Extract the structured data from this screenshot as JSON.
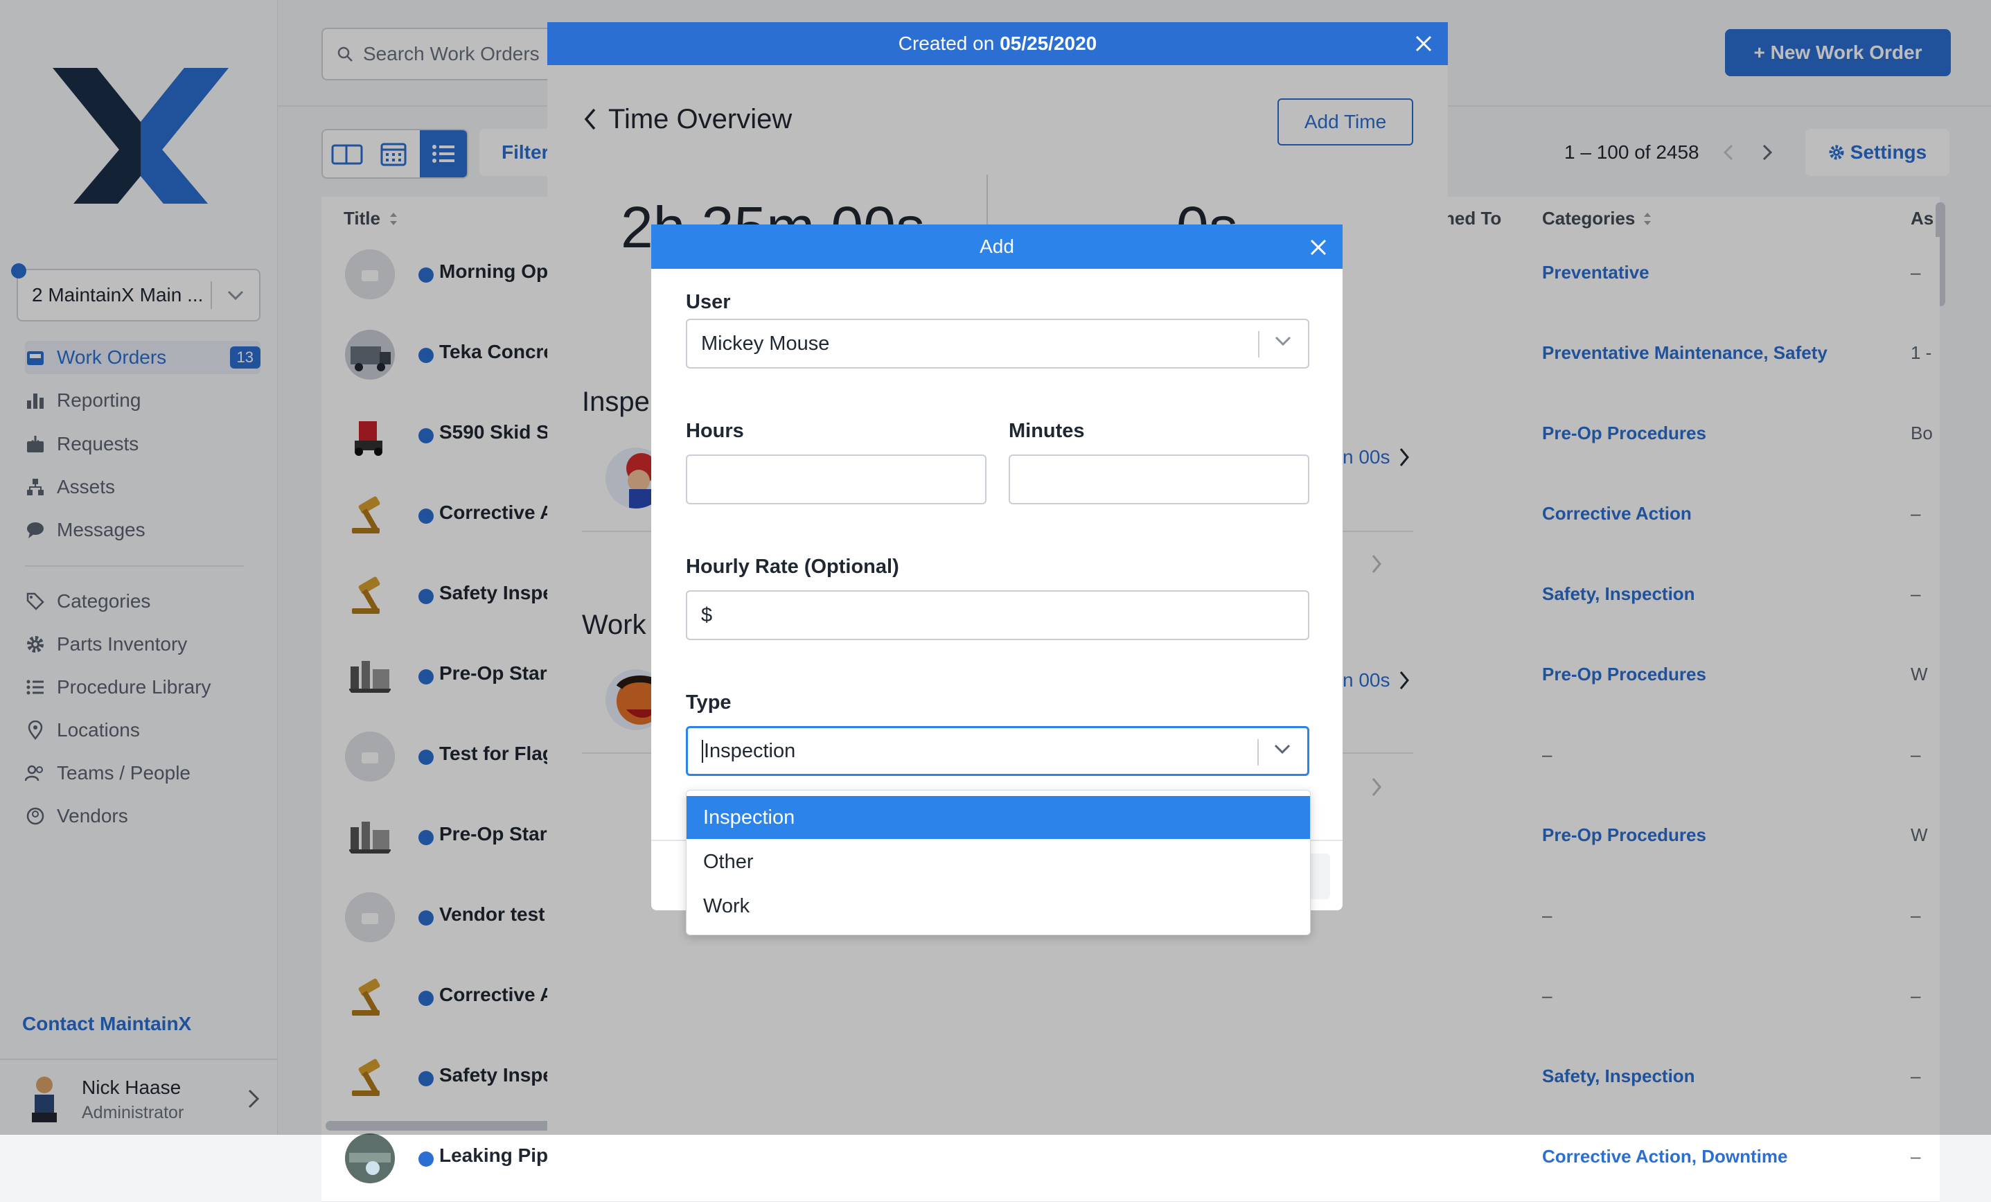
{
  "colors": {
    "accent": "#2c6fd3",
    "accent_light": "#2c83ea",
    "text": "#1f2733",
    "muted": "#5b6472"
  },
  "sidebar": {
    "location": "2 MaintainX Main ...",
    "nav": [
      {
        "label": "Work Orders",
        "icon": "inbox-icon",
        "badge": "13",
        "active": true
      },
      {
        "label": "Reporting",
        "icon": "bar-chart-icon"
      },
      {
        "label": "Requests",
        "icon": "request-tray-icon"
      },
      {
        "label": "Assets",
        "icon": "hierarchy-icon"
      },
      {
        "label": "Messages",
        "icon": "chat-icon"
      }
    ],
    "nav2": [
      {
        "label": "Categories",
        "icon": "tag-icon"
      },
      {
        "label": "Parts Inventory",
        "icon": "gear-icon"
      },
      {
        "label": "Procedure Library",
        "icon": "list-icon"
      },
      {
        "label": "Locations",
        "icon": "pin-icon"
      },
      {
        "label": "Teams / People",
        "icon": "people-icon"
      },
      {
        "label": "Vendors",
        "icon": "vendors-icon"
      }
    ],
    "contact": "Contact MaintainX",
    "user": {
      "name": "Nick Haase",
      "role": "Administrator"
    }
  },
  "topbar": {
    "search_placeholder": "Search Work Orders",
    "new_button": "+ New Work Order"
  },
  "toolbar": {
    "filter": "Filter",
    "pagination": "1 – 100 of 2458",
    "settings": "Settings"
  },
  "table": {
    "headers": {
      "title": "Title",
      "assigned": "ned To",
      "categories": "Categories",
      "as": "As"
    },
    "rows": [
      {
        "title": "Morning Op",
        "cat": "Preventative",
        "as": "–",
        "av": "grey"
      },
      {
        "title": "Teka Concre",
        "cat": "Preventative Maintenance, Safety",
        "as": "1 -",
        "av": "truck"
      },
      {
        "title": "S590 Skid S",
        "cat": "Pre-Op Procedures",
        "as": "Bo",
        "av": "skid"
      },
      {
        "title": "Corrective A",
        "cat": "Corrective Action",
        "as": "–",
        "av": "gavel"
      },
      {
        "title": "Safety Inspe",
        "cat": "Safety, Inspection",
        "as": "–",
        "av": "gavel"
      },
      {
        "title": "Pre-Op Star",
        "cat": "Pre-Op Procedures",
        "as": "W",
        "av": "plant"
      },
      {
        "title": "Test for Flag",
        "cat": "–",
        "as": "–",
        "av": "grey"
      },
      {
        "title": "Pre-Op Star",
        "cat": "Pre-Op Procedures",
        "as": "W",
        "av": "plant"
      },
      {
        "title": "Vendor test",
        "cat": "–",
        "as": "–",
        "av": "grey"
      },
      {
        "title": "Corrective A",
        "cat": "–",
        "as": "–",
        "av": "gavel"
      },
      {
        "title": "Safety Inspe",
        "cat": "Safety, Inspection",
        "as": "–",
        "av": "gavel"
      },
      {
        "title": "Leaking Pip",
        "cat": "Corrective Action, Downtime",
        "as": "–",
        "av": "pipe"
      }
    ]
  },
  "panel": {
    "header_prefix": "Created on ",
    "header_date": "05/25/2020",
    "title": "Time Overview",
    "add_time": "Add Time",
    "total_left": "2h 35m 00s",
    "total_right": "0s",
    "section_inspection": "Inspe",
    "section_work": "Work",
    "entry_time_1": "n 00s",
    "entry_time_2": "n 00s"
  },
  "modal": {
    "title": "Add",
    "user_label": "User",
    "user_value": "Mickey Mouse",
    "hours_label": "Hours",
    "minutes_label": "Minutes",
    "rate_label": "Hourly Rate (Optional)",
    "rate_prefix": "$",
    "type_label": "Type",
    "type_value": "Inspection",
    "options": [
      "Inspection",
      "Other",
      "Work"
    ]
  }
}
